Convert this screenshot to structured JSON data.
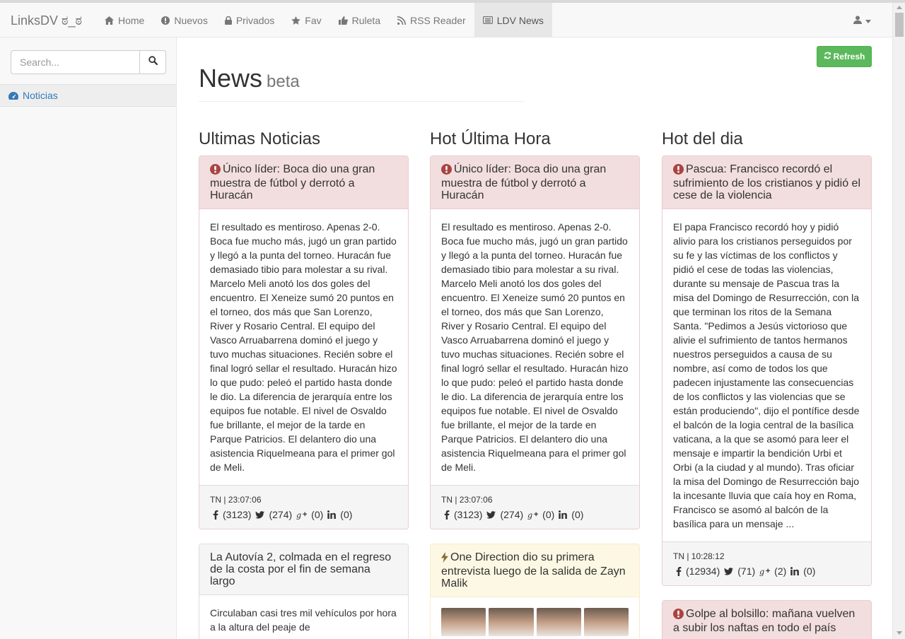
{
  "navbar": {
    "brand": "LinksDV ಠ_ಠ",
    "items": [
      {
        "label": "Home",
        "icon": "home-icon"
      },
      {
        "label": "Nuevos",
        "icon": "exclamation-circle-icon"
      },
      {
        "label": "Privados",
        "icon": "lock-icon"
      },
      {
        "label": "Fav",
        "icon": "star-icon"
      },
      {
        "label": "Ruleta",
        "icon": "thumbs-up-icon"
      },
      {
        "label": "RSS Reader",
        "icon": "rss-icon"
      },
      {
        "label": "LDV News",
        "icon": "newspaper-icon",
        "active": true
      }
    ],
    "user_icon": "user-icon"
  },
  "sidebar": {
    "search_placeholder": "Search...",
    "items": [
      {
        "label": "Noticias",
        "icon": "dashboard-icon"
      }
    ]
  },
  "page": {
    "title": "News",
    "subtitle": "beta",
    "refresh_label": "Refresh"
  },
  "columns": [
    {
      "title": "Ultimas Noticias",
      "cards": [
        {
          "style": "danger",
          "icon": "exclamation-circle-icon",
          "title": "Único líder: Boca dio una gran muestra de fútbol y derrotó a Huracán",
          "body": "El resultado es mentiroso. Apenas 2-0. Boca fue mucho más, jugó un gran partido y llegó a la punta del torneo. Huracán fue demasiado tibio para molestar a su rival. Marcelo Meli anotó los dos goles del encuentro. El Xeneize sumó 20 puntos en el torneo, dos más que San Lorenzo, River y Rosario Central. El equipo del Vasco Arruabarrena dominó el juego y tuvo muchas situaciones. Recién sobre el final logró sellar el resultado. Huracán hizo lo que pudo: peleó el partido hasta donde le dio. La diferencia de jerarquía entre los equipos fue notable. El nivel de Osvaldo fue brillante, el mejor de la tarde en Parque Patricios. El delantero dio una asistencia Riquelmeana para el primer gol de Meli.",
          "meta": "TN | 23:07:06",
          "facebook": "(3123)",
          "twitter": "(274)",
          "gplus": "(0)",
          "linkedin": "(0)"
        },
        {
          "style": "default",
          "icon": "",
          "title": "La Autovía 2, colmada en el regreso de la costa por el fin de semana largo",
          "body": "Circulaban casi tres mil vehículos por hora a la altura del peaje de"
        }
      ]
    },
    {
      "title": "Hot Última Hora",
      "cards": [
        {
          "style": "danger",
          "icon": "exclamation-circle-icon",
          "title": "Único líder: Boca dio una gran muestra de fútbol y derrotó a Huracán",
          "body": "El resultado es mentiroso. Apenas 2-0. Boca fue mucho más, jugó un gran partido y llegó a la punta del torneo. Huracán fue demasiado tibio para molestar a su rival. Marcelo Meli anotó los dos goles del encuentro. El Xeneize sumó 20 puntos en el torneo, dos más que San Lorenzo, River y Rosario Central. El equipo del Vasco Arruabarrena dominó el juego y tuvo muchas situaciones. Recién sobre el final logró sellar el resultado. Huracán hizo lo que pudo: peleó el partido hasta donde le dio. La diferencia de jerarquía entre los equipos fue notable. El nivel de Osvaldo fue brillante, el mejor de la tarde en Parque Patricios. El delantero dio una asistencia Riquelmeana para el primer gol de Meli.",
          "meta": "TN | 23:07:06",
          "facebook": "(3123)",
          "twitter": "(274)",
          "gplus": "(0)",
          "linkedin": "(0)"
        },
        {
          "style": "warning",
          "icon": "bolt-icon",
          "title": "One Direction dio su primera entrevista luego de la salida de Zayn Malik",
          "body": ""
        }
      ]
    },
    {
      "title": "Hot del dia",
      "cards": [
        {
          "style": "danger",
          "icon": "exclamation-circle-icon",
          "title": "Pascua: Francisco recordó el sufrimiento de los cristianos y pidió el cese de la violencia",
          "body": "El papa Francisco recordó hoy y pidió alivio para los cristianos perseguidos por su fe y las víctimas de los conflictos y pidió el cese de todas las violencias, durante su mensaje de Pascua tras la misa del Domingo de Resurrección, con la que terminan los ritos de la Semana Santa. \"Pedimos a Jesús victorioso que alivie el sufrimiento de tantos hermanos nuestros perseguidos a causa de su nombre, así como de todos los que padecen injustamente las consecuencias de los conflictos y las violencias que se están produciendo\", dijo el pontífice desde el balcón de la logia central de la basílica vaticana, a la que se asomó para leer el mensaje e impartir la bendición Urbi et Orbi (a la ciudad y al mundo). Tras oficiar la misa del Domingo de Resurrección bajo la incesante lluvia que caía hoy en Roma, Francisco se asomó al balcón de la basílica para un mensaje ...",
          "meta": "TN | 10:28:12",
          "facebook": "(12934)",
          "twitter": "(71)",
          "gplus": "(2)",
          "linkedin": "(0)"
        },
        {
          "style": "danger",
          "icon": "exclamation-circle-icon",
          "title": "Golpe al bolsillo: mañana vuelven a subir los naftas en todo el país",
          "body": ""
        }
      ]
    }
  ]
}
